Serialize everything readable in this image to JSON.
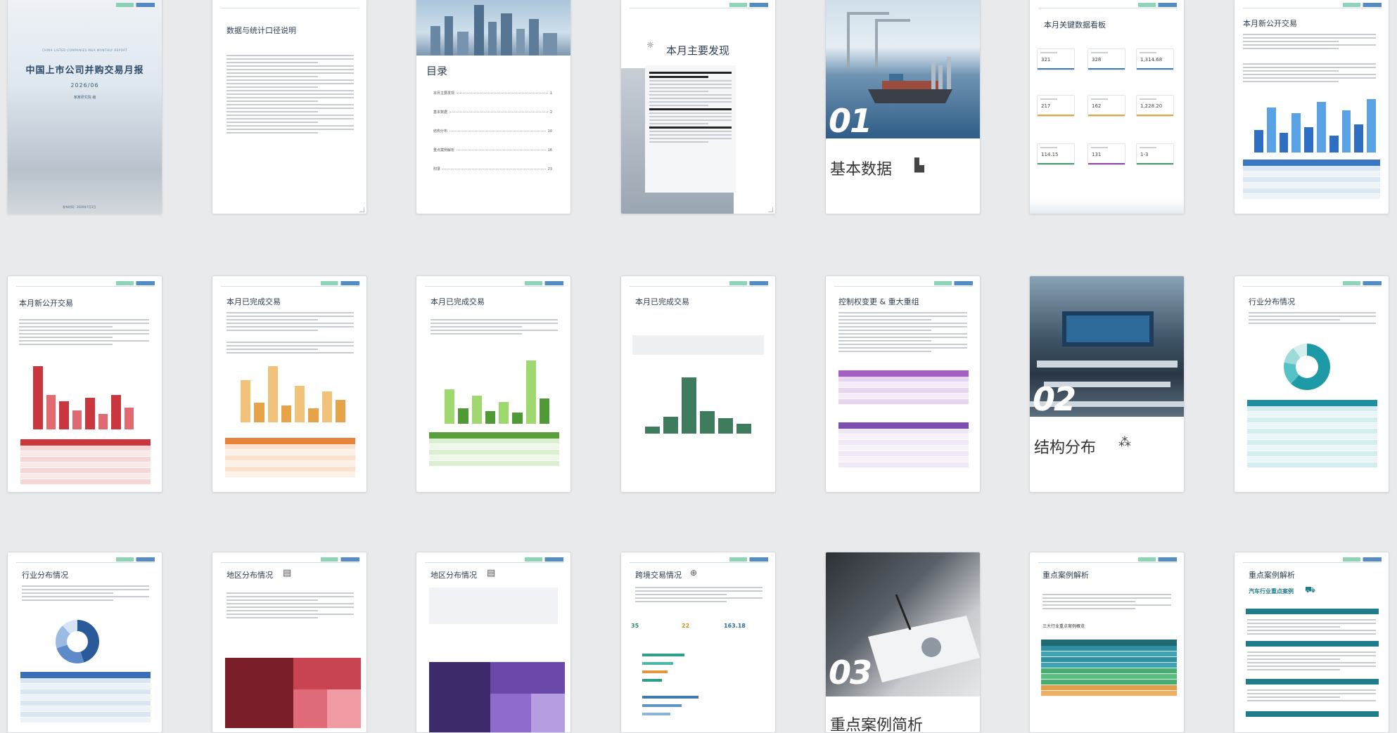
{
  "cover": {
    "subtitle": "CHINA LISTED COMPANIES M&A MONTHLY REPORT",
    "title": "中国上市公司并购交易月报",
    "date": "2026/06",
    "org": "某某研究院 编",
    "footer": "发布时间：2026年7月3日"
  },
  "p2_title": "数据与统计口径说明",
  "toc": {
    "title": "目录",
    "items": [
      {
        "label": "本月主要发现",
        "page": "1"
      },
      {
        "label": "基本数据",
        "page": "2"
      },
      {
        "label": "结构分布",
        "page": "10"
      },
      {
        "label": "重点案例解析",
        "page": "16"
      },
      {
        "label": "附录",
        "page": "23"
      }
    ]
  },
  "findings_title": "本月主要发现",
  "section1": {
    "num": "01",
    "label": "基本数据"
  },
  "dashboard": {
    "title": "本月关键数据看板",
    "kpis": [
      {
        "value": "321",
        "color": "#3f7fc0"
      },
      {
        "value": "328",
        "color": "#3f7fc0"
      },
      {
        "value": "1,314.68",
        "color": "#3f7fc0"
      },
      {
        "value": "217",
        "color": "#e0a43c"
      },
      {
        "value": "162",
        "color": "#e0a43c"
      },
      {
        "value": "1,228.20",
        "color": "#e0a43c"
      },
      {
        "value": "114.15",
        "color": "#4a9c6c"
      },
      {
        "value": "131",
        "color": "#8a4ca6"
      },
      {
        "value": "1-3",
        "color": "#4a9c6c"
      }
    ]
  },
  "p7_title": "本月新公开交易",
  "p8_title": "本月新公开交易",
  "p9_title": "本月已完成交易",
  "p10_title": "本月已完成交易",
  "p11_title": "本月已完成交易",
  "p12_title": "控制权变更 & 重大重组",
  "section2": {
    "num": "02",
    "label": "结构分布"
  },
  "p14_title": "行业分布情况",
  "p15_title": "行业分布情况",
  "p16_title": "地区分布情况",
  "p17_title": "地区分布情况",
  "p18_title": "跨境交易情况",
  "p18_stats": [
    "35",
    "22",
    "163.18"
  ],
  "section3": {
    "num": "03",
    "label": "重点案例简析"
  },
  "p20_title": "重点案例解析",
  "p20_sub": "三大行业重点案例概览",
  "p21_title": "重点案例解析",
  "p21_sub": "汽车行业重点案例"
}
